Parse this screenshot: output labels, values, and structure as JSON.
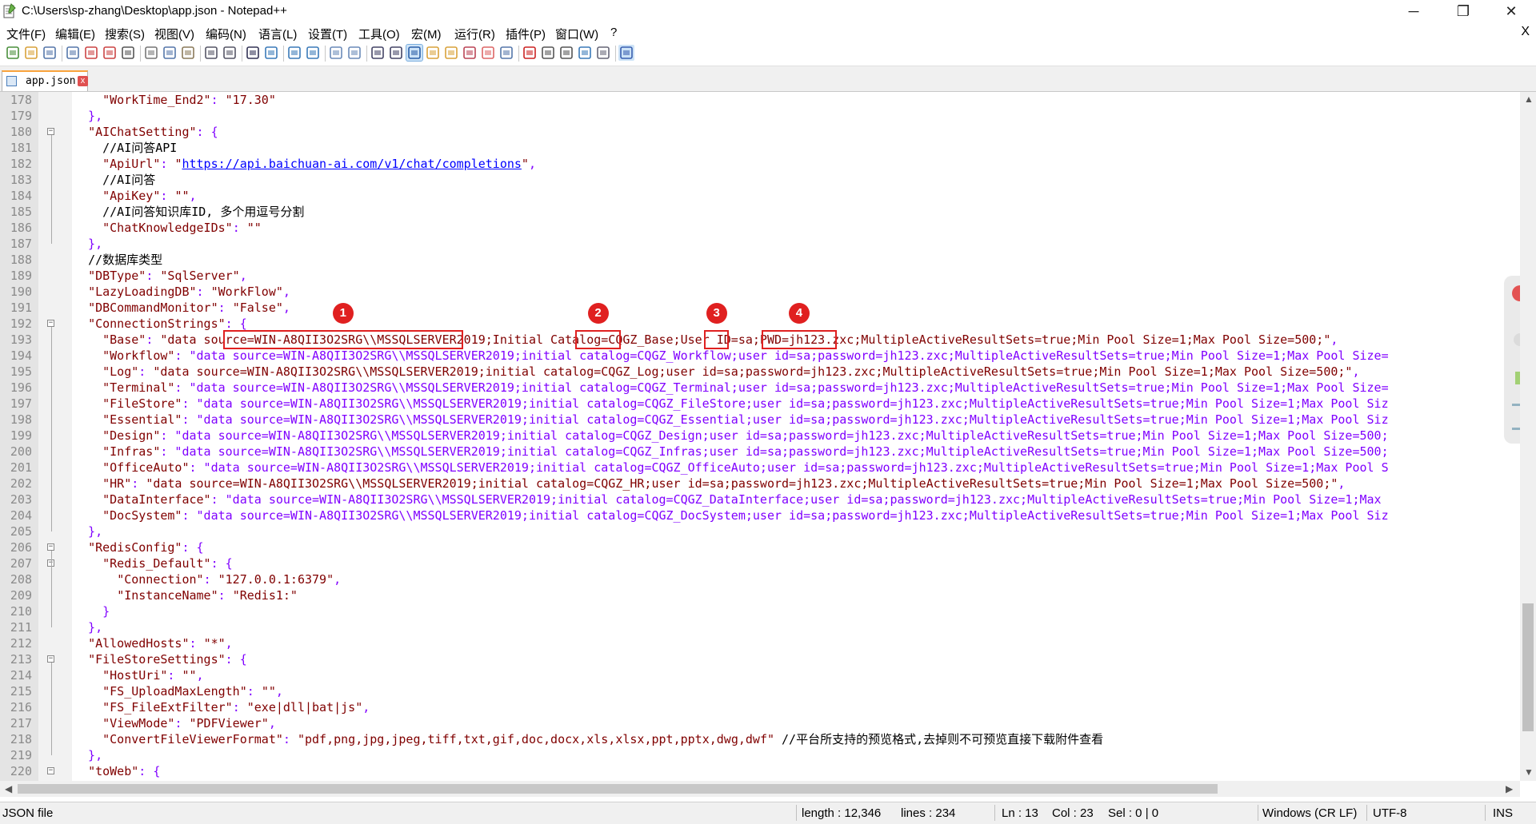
{
  "window": {
    "title": "C:\\Users\\sp-zhang\\Desktop\\app.json - Notepad++",
    "minimize": "─",
    "maximize": "❐",
    "close": "✕"
  },
  "menu": {
    "items": [
      "文件(F)",
      "编辑(E)",
      "搜索(S)",
      "视图(V)",
      "编码(N)",
      "语言(L)",
      "设置(T)",
      "工具(O)",
      "宏(M)",
      "运行(R)",
      "插件(P)",
      "窗口(W)",
      "?"
    ],
    "close": "X"
  },
  "tab": {
    "label": "app.json",
    "close": "x"
  },
  "toolbar": {
    "icons": [
      "new-file-icon",
      "open-file-icon",
      "save-icon",
      "save-all-icon",
      "close-icon",
      "close-all-icon",
      "print-icon",
      "cut-icon",
      "copy-icon",
      "paste-icon",
      "undo-icon",
      "redo-icon",
      "find-icon",
      "replace-icon",
      "zoom-in-icon",
      "zoom-out-icon",
      "sync-v-icon",
      "sync-h-icon",
      "word-wrap-icon",
      "show-all-chars-icon",
      "indent-guide-icon",
      "udl-icon",
      "doc-map-icon",
      "function-list-icon",
      "folder-workspace-icon",
      "monitor-icon",
      "record-macro-icon",
      "stop-macro-icon",
      "play-macro-icon",
      "run-macro-multiple-icon",
      "save-macro-icon",
      "spell-check-icon"
    ]
  },
  "markers": [
    "1",
    "2",
    "3",
    "4"
  ],
  "lines": [
    {
      "n": "178",
      "fold": "",
      "t": "    \"WorkTime_End2\": \"17.30\""
    },
    {
      "n": "179",
      "fold": "",
      "t": "  },"
    },
    {
      "n": "180",
      "fold": "−",
      "t": "  \"AIChatSetting\": {"
    },
    {
      "n": "181",
      "fold": "",
      "t": "    //AI问答API"
    },
    {
      "n": "182",
      "fold": "",
      "t": "    \"ApiUrl\": \"https://api.baichuan-ai.com/v1/chat/completions\","
    },
    {
      "n": "183",
      "fold": "",
      "t": "    //AI问答"
    },
    {
      "n": "184",
      "fold": "",
      "t": "    \"ApiKey\": \"\","
    },
    {
      "n": "185",
      "fold": "",
      "t": "    //AI问答知识库ID, 多个用逗号分割"
    },
    {
      "n": "186",
      "fold": "",
      "t": "    \"ChatKnowledgeIDs\": \"\""
    },
    {
      "n": "187",
      "fold": "",
      "t": "  },"
    },
    {
      "n": "188",
      "fold": "",
      "t": "  //数据库类型"
    },
    {
      "n": "189",
      "fold": "",
      "t": "  \"DBType\": \"SqlServer\","
    },
    {
      "n": "190",
      "fold": "",
      "t": "  \"LazyLoadingDB\": \"WorkFlow\","
    },
    {
      "n": "191",
      "fold": "",
      "t": "  \"DBCommandMonitor\": \"False\","
    },
    {
      "n": "192",
      "fold": "−",
      "t": "  \"ConnectionStrings\": {"
    },
    {
      "n": "193",
      "fold": "",
      "t": "    \"Base\": \"data source=WIN-A8QII3O2SRG\\\\MSSQLSERVER2019;Initial Catalog=CQGZ_Base;User ID=sa;PWD=jh123.zxc;MultipleActiveResultSets=true;Min Pool Size=1;Max Pool Size=500;\","
    },
    {
      "n": "194",
      "fold": "",
      "t": "    \"Workflow\": \"data source=WIN-A8QII3O2SRG\\\\MSSQLSERVER2019;initial catalog=CQGZ_Workflow;user id=sa;password=jh123.zxc;MultipleActiveResultSets=true;Min Pool Size=1;Max Pool Size="
    },
    {
      "n": "195",
      "fold": "",
      "t": "    \"Log\": \"data source=WIN-A8QII3O2SRG\\\\MSSQLSERVER2019;initial catalog=CQGZ_Log;user id=sa;password=jh123.zxc;MultipleActiveResultSets=true;Min Pool Size=1;Max Pool Size=500;\","
    },
    {
      "n": "196",
      "fold": "",
      "t": "    \"Terminal\": \"data source=WIN-A8QII3O2SRG\\\\MSSQLSERVER2019;initial catalog=CQGZ_Terminal;user id=sa;password=jh123.zxc;MultipleActiveResultSets=true;Min Pool Size=1;Max Pool Size="
    },
    {
      "n": "197",
      "fold": "",
      "t": "    \"FileStore\": \"data source=WIN-A8QII3O2SRG\\\\MSSQLSERVER2019;initial catalog=CQGZ_FileStore;user id=sa;password=jh123.zxc;MultipleActiveResultSets=true;Min Pool Size=1;Max Pool Siz"
    },
    {
      "n": "198",
      "fold": "",
      "t": "    \"Essential\": \"data source=WIN-A8QII3O2SRG\\\\MSSQLSERVER2019;initial catalog=CQGZ_Essential;user id=sa;password=jh123.zxc;MultipleActiveResultSets=true;Min Pool Size=1;Max Pool Siz"
    },
    {
      "n": "199",
      "fold": "",
      "t": "    \"Design\": \"data source=WIN-A8QII3O2SRG\\\\MSSQLSERVER2019;initial catalog=CQGZ_Design;user id=sa;password=jh123.zxc;MultipleActiveResultSets=true;Min Pool Size=1;Max Pool Size=500;"
    },
    {
      "n": "200",
      "fold": "",
      "t": "    \"Infras\": \"data source=WIN-A8QII3O2SRG\\\\MSSQLSERVER2019;initial catalog=CQGZ_Infras;user id=sa;password=jh123.zxc;MultipleActiveResultSets=true;Min Pool Size=1;Max Pool Size=500;"
    },
    {
      "n": "201",
      "fold": "",
      "t": "    \"OfficeAuto\": \"data source=WIN-A8QII3O2SRG\\\\MSSQLSERVER2019;initial catalog=CQGZ_OfficeAuto;user id=sa;password=jh123.zxc;MultipleActiveResultSets=true;Min Pool Size=1;Max Pool S"
    },
    {
      "n": "202",
      "fold": "",
      "t": "    \"HR\": \"data source=WIN-A8QII3O2SRG\\\\MSSQLSERVER2019;initial catalog=CQGZ_HR;user id=sa;password=jh123.zxc;MultipleActiveResultSets=true;Min Pool Size=1;Max Pool Size=500;\","
    },
    {
      "n": "203",
      "fold": "",
      "t": "    \"DataInterface\": \"data source=WIN-A8QII3O2SRG\\\\MSSQLSERVER2019;initial catalog=CQGZ_DataInterface;user id=sa;password=jh123.zxc;MultipleActiveResultSets=true;Min Pool Size=1;Max"
    },
    {
      "n": "204",
      "fold": "",
      "t": "    \"DocSystem\": \"data source=WIN-A8QII3O2SRG\\\\MSSQLSERVER2019;initial catalog=CQGZ_DocSystem;user id=sa;password=jh123.zxc;MultipleActiveResultSets=true;Min Pool Size=1;Max Pool Siz"
    },
    {
      "n": "205",
      "fold": "",
      "t": "  },"
    },
    {
      "n": "206",
      "fold": "−",
      "t": "  \"RedisConfig\": {"
    },
    {
      "n": "207",
      "fold": "−",
      "t": "    \"Redis_Default\": {"
    },
    {
      "n": "208",
      "fold": "",
      "t": "      \"Connection\": \"127.0.0.1:6379\","
    },
    {
      "n": "209",
      "fold": "",
      "t": "      \"InstanceName\": \"Redis1:\""
    },
    {
      "n": "210",
      "fold": "",
      "t": "    }"
    },
    {
      "n": "211",
      "fold": "",
      "t": "  },"
    },
    {
      "n": "212",
      "fold": "",
      "t": "  \"AllowedHosts\": \"*\","
    },
    {
      "n": "213",
      "fold": "−",
      "t": "  \"FileStoreSettings\": {"
    },
    {
      "n": "214",
      "fold": "",
      "t": "    \"HostUri\": \"\","
    },
    {
      "n": "215",
      "fold": "",
      "t": "    \"FS_UploadMaxLength\": \"\","
    },
    {
      "n": "216",
      "fold": "",
      "t": "    \"FS_FileExtFilter\": \"exe|dll|bat|js\","
    },
    {
      "n": "217",
      "fold": "",
      "t": "    \"ViewMode\": \"PDFViewer\","
    },
    {
      "n": "218",
      "fold": "",
      "t": "    \"ConvertFileViewerFormat\": \"pdf,png,jpg,jpeg,tiff,txt,gif,doc,docx,xls,xlsx,ppt,pptx,dwg,dwf\" //平台所支持的预览格式,去掉则不可预览直接下载附件查看"
    },
    {
      "n": "219",
      "fold": "",
      "t": "  },"
    },
    {
      "n": "220",
      "fold": "−",
      "t": "  \"toWeb\": {"
    }
  ],
  "status": {
    "filetype": "JSON file",
    "length": "length : 12,346",
    "lines": "lines : 234",
    "ln": "Ln : 13",
    "col": "Col : 23",
    "sel": "Sel : 0 | 0",
    "eol": "Windows (CR LF)",
    "encoding": "UTF-8",
    "mode": "INS"
  },
  "colors": {
    "keyword": "#8000ff",
    "string": "#800000",
    "highlight_box": "#e02020",
    "tab_accent": "#f9a33c"
  }
}
